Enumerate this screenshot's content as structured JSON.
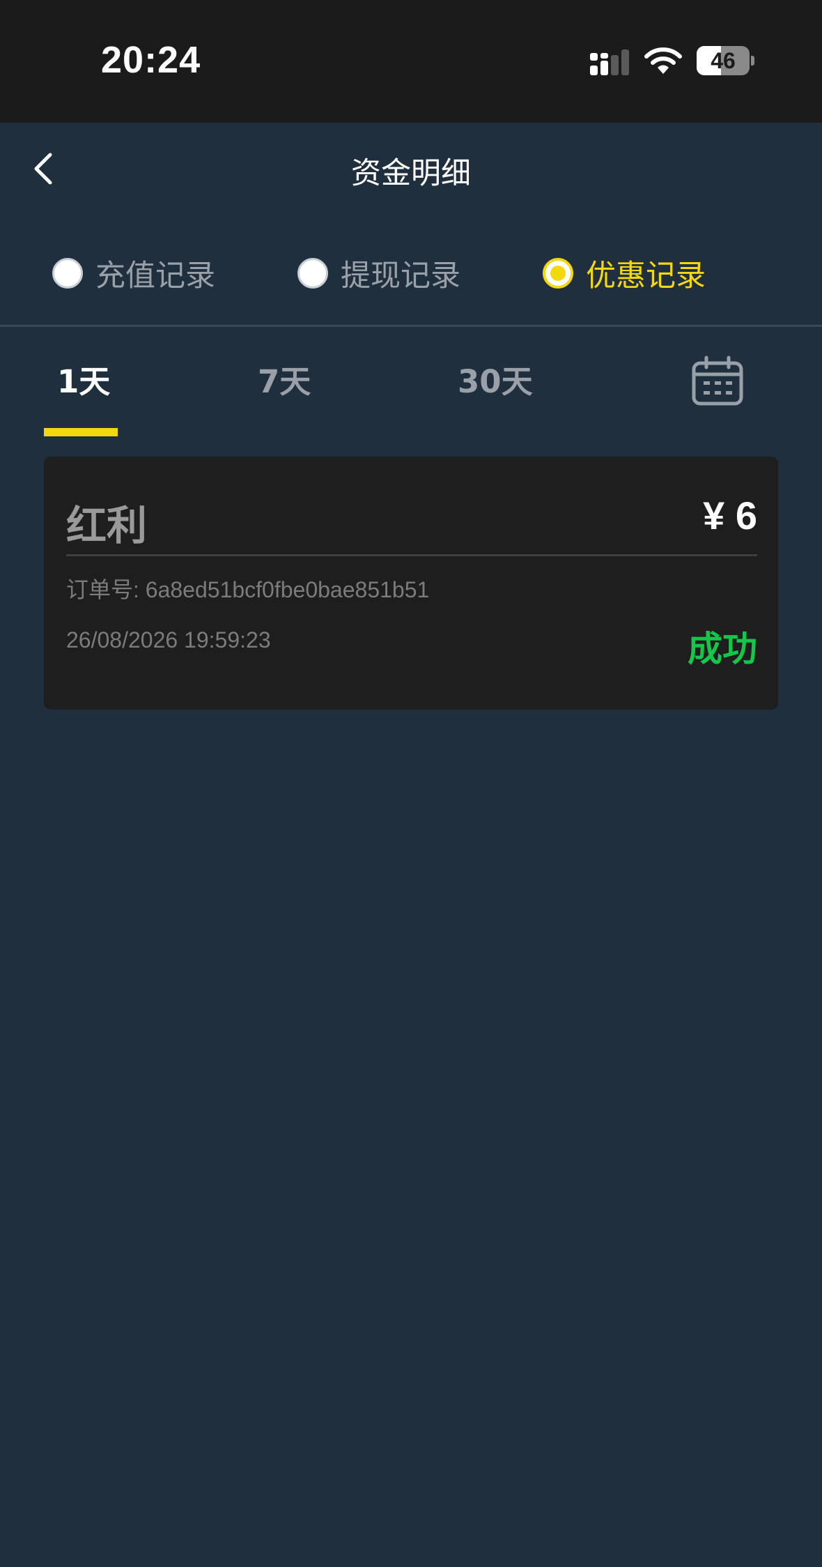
{
  "status_bar": {
    "time": "20:24",
    "battery_level": "46",
    "icons": [
      "signal-icon",
      "wifi-icon",
      "battery-icon"
    ]
  },
  "header": {
    "title": "资金明细",
    "back_icon": "chevron-left-icon"
  },
  "record_types": {
    "items": [
      {
        "label": "充值记录",
        "selected": false
      },
      {
        "label": "提现记录",
        "selected": false
      },
      {
        "label": "优惠记录",
        "selected": true
      }
    ]
  },
  "day_tabs": {
    "items": [
      {
        "label": "1天",
        "active": true
      },
      {
        "label": "7天",
        "active": false
      },
      {
        "label": "30天",
        "active": false
      }
    ],
    "calendar_icon": "calendar-icon"
  },
  "records": [
    {
      "type": "红利",
      "amount": "¥ 6",
      "order_no": "订单号: 6a8ed51bcf0fbe0bae851b51",
      "time": "26/08/2026 19:59:23",
      "status": "成功"
    }
  ],
  "colors": {
    "accent": "#f4d80f",
    "success": "#12c74a",
    "background": "#1f2f3d",
    "card": "#1e1e1e"
  }
}
